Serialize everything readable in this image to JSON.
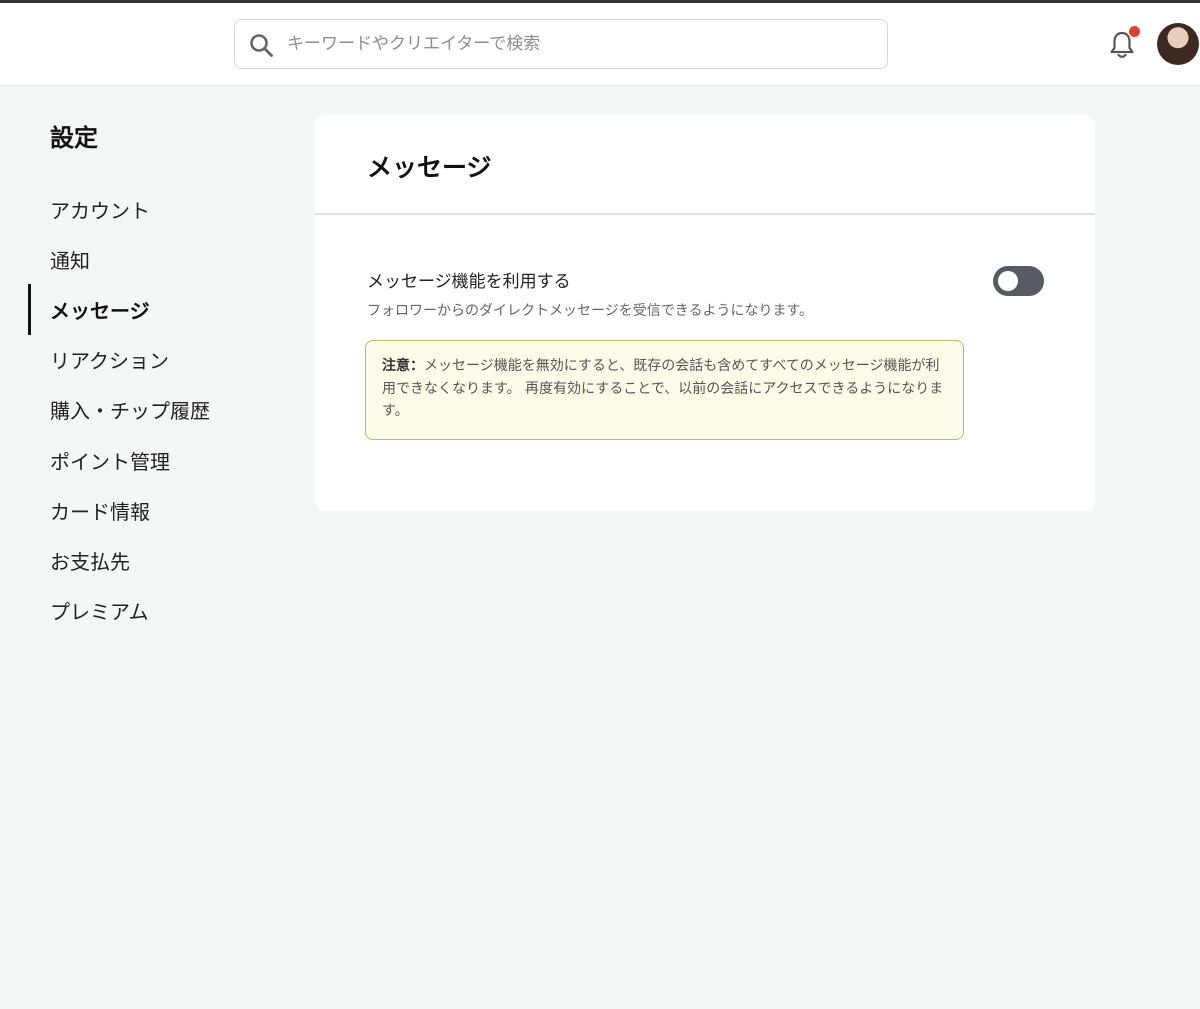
{
  "search": {
    "placeholder": "キーワードやクリエイターで検索"
  },
  "header": {
    "notification_icon": "bell-icon",
    "avatar": "user-avatar",
    "accent_dot_color": "#e0403a"
  },
  "sidebar": {
    "title": "設定",
    "items": [
      {
        "label": "アカウント"
      },
      {
        "label": "通知"
      },
      {
        "label": "メッセージ",
        "active": true
      },
      {
        "label": "リアクション"
      },
      {
        "label": "購入・チップ履歴"
      },
      {
        "label": "ポイント管理"
      },
      {
        "label": "カード情報"
      },
      {
        "label": "お支払先"
      },
      {
        "label": "プレミアム"
      }
    ]
  },
  "main": {
    "title": "メッセージ",
    "setting": {
      "label": "メッセージ機能を利用する",
      "description": "フォロワーからのダイレクトメッセージを受信できるようになります。",
      "toggle_enabled": false
    },
    "notice": {
      "strong": "注意：",
      "text": "メッセージ機能を無効にすると、既存の会話も含めてすべてのメッセージ機能が利用できなくなります。 再度有効にすることで、以前の会話にアクセスできるようになります。"
    }
  }
}
